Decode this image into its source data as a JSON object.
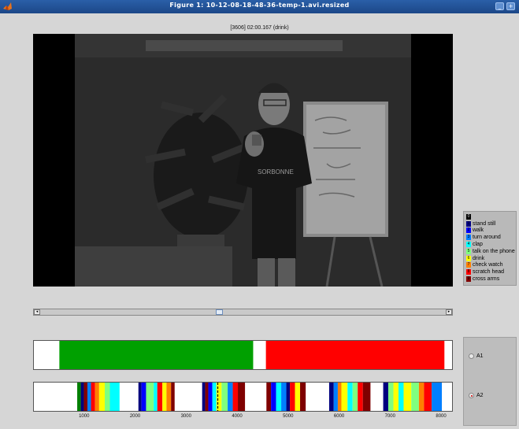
{
  "window": {
    "title": "Figure 1: 10-12-08-18-48-36-temp-1.avi.resized",
    "minimize_label": "_",
    "maximize_label": "+"
  },
  "video": {
    "status": "[3606] 02:00.167  (drink)",
    "shirt_text": "SORBONNE"
  },
  "legend": {
    "items": [
      {
        "key": "0",
        "label": "",
        "color": "#000000"
      },
      {
        "key": "1",
        "label": "stand still",
        "color": "#00007f"
      },
      {
        "key": "2",
        "label": "walk",
        "color": "#0000ff"
      },
      {
        "key": "3",
        "label": "turn around",
        "color": "#007fff"
      },
      {
        "key": "4",
        "label": "clap",
        "color": "#00ffff"
      },
      {
        "key": "5",
        "label": "talk on the phone",
        "color": "#7fff7f"
      },
      {
        "key": "6",
        "label": "drink",
        "color": "#ffff00"
      },
      {
        "key": "7",
        "label": "check watch",
        "color": "#ff7f00"
      },
      {
        "key": "8",
        "label": "scratch head",
        "color": "#ff0000"
      },
      {
        "key": "9",
        "label": "cross arms",
        "color": "#7f0000"
      }
    ]
  },
  "scrollbar": {
    "left_arrow": "◂",
    "right_arrow": "▸",
    "position": 0.44
  },
  "timeline": {
    "range": [
      0,
      8200
    ],
    "ticks": [
      "1000",
      "2000",
      "3000",
      "4000",
      "5000",
      "6000",
      "7000",
      "8000"
    ],
    "current_frame": 3606,
    "track1": [
      {
        "start": 500,
        "end": 4300,
        "color": "#00a000"
      },
      {
        "start": 4550,
        "end": 8050,
        "color": "#ff0000"
      }
    ],
    "track2": [
      {
        "start": 850,
        "end": 920,
        "color": "#007f00"
      },
      {
        "start": 920,
        "end": 980,
        "color": "#00007f"
      },
      {
        "start": 980,
        "end": 1050,
        "color": "#7f0000"
      },
      {
        "start": 1050,
        "end": 1120,
        "color": "#007fff"
      },
      {
        "start": 1120,
        "end": 1200,
        "color": "#ff0000"
      },
      {
        "start": 1200,
        "end": 1280,
        "color": "#ff7f00"
      },
      {
        "start": 1280,
        "end": 1390,
        "color": "#ffff00"
      },
      {
        "start": 1390,
        "end": 1490,
        "color": "#7fff7f"
      },
      {
        "start": 1490,
        "end": 1680,
        "color": "#00ffff"
      },
      {
        "start": 2050,
        "end": 2110,
        "color": "#00007f"
      },
      {
        "start": 2110,
        "end": 2200,
        "color": "#0000ff"
      },
      {
        "start": 2200,
        "end": 2350,
        "color": "#7fff7f"
      },
      {
        "start": 2350,
        "end": 2420,
        "color": "#00ffff"
      },
      {
        "start": 2420,
        "end": 2520,
        "color": "#ff0000"
      },
      {
        "start": 2520,
        "end": 2600,
        "color": "#ffff00"
      },
      {
        "start": 2600,
        "end": 2690,
        "color": "#ff7f00"
      },
      {
        "start": 2690,
        "end": 2760,
        "color": "#7f0000"
      },
      {
        "start": 3300,
        "end": 3360,
        "color": "#00007f"
      },
      {
        "start": 3360,
        "end": 3420,
        "color": "#7f0000"
      },
      {
        "start": 3420,
        "end": 3500,
        "color": "#0000ff"
      },
      {
        "start": 3500,
        "end": 3580,
        "color": "#00ffff"
      },
      {
        "start": 3580,
        "end": 3680,
        "color": "#ffff00"
      },
      {
        "start": 3680,
        "end": 3800,
        "color": "#7fff7f"
      },
      {
        "start": 3800,
        "end": 3900,
        "color": "#007fff"
      },
      {
        "start": 3900,
        "end": 4000,
        "color": "#ff0000"
      },
      {
        "start": 4000,
        "end": 4140,
        "color": "#7f0000"
      },
      {
        "start": 4560,
        "end": 4650,
        "color": "#7f0000"
      },
      {
        "start": 4650,
        "end": 4750,
        "color": "#0000ff"
      },
      {
        "start": 4750,
        "end": 4850,
        "color": "#00ffff"
      },
      {
        "start": 4850,
        "end": 4950,
        "color": "#007fff"
      },
      {
        "start": 4950,
        "end": 5020,
        "color": "#00007f"
      },
      {
        "start": 5020,
        "end": 5120,
        "color": "#ff0000"
      },
      {
        "start": 5120,
        "end": 5220,
        "color": "#ffff00"
      },
      {
        "start": 5220,
        "end": 5330,
        "color": "#7f0000"
      },
      {
        "start": 5790,
        "end": 5880,
        "color": "#00007f"
      },
      {
        "start": 5880,
        "end": 5960,
        "color": "#007fff"
      },
      {
        "start": 5960,
        "end": 6030,
        "color": "#ff7f00"
      },
      {
        "start": 6030,
        "end": 6150,
        "color": "#ffff00"
      },
      {
        "start": 6150,
        "end": 6250,
        "color": "#00ffff"
      },
      {
        "start": 6250,
        "end": 6350,
        "color": "#7fff7f"
      },
      {
        "start": 6350,
        "end": 6450,
        "color": "#ff0000"
      },
      {
        "start": 6450,
        "end": 6600,
        "color": "#7f0000"
      },
      {
        "start": 6850,
        "end": 6950,
        "color": "#00007f"
      },
      {
        "start": 6950,
        "end": 7050,
        "color": "#7fff7f"
      },
      {
        "start": 7050,
        "end": 7150,
        "color": "#ffff00"
      },
      {
        "start": 7150,
        "end": 7250,
        "color": "#00ffff"
      },
      {
        "start": 7250,
        "end": 7400,
        "color": "#ffff00"
      },
      {
        "start": 7400,
        "end": 7550,
        "color": "#7fff7f"
      },
      {
        "start": 7550,
        "end": 7650,
        "color": "#ff7f00"
      },
      {
        "start": 7650,
        "end": 7800,
        "color": "#ff0000"
      },
      {
        "start": 7800,
        "end": 8000,
        "color": "#007fff"
      }
    ]
  },
  "annotators": {
    "options": [
      {
        "label": "A1",
        "selected": false
      },
      {
        "label": "A2",
        "selected": true
      }
    ]
  }
}
